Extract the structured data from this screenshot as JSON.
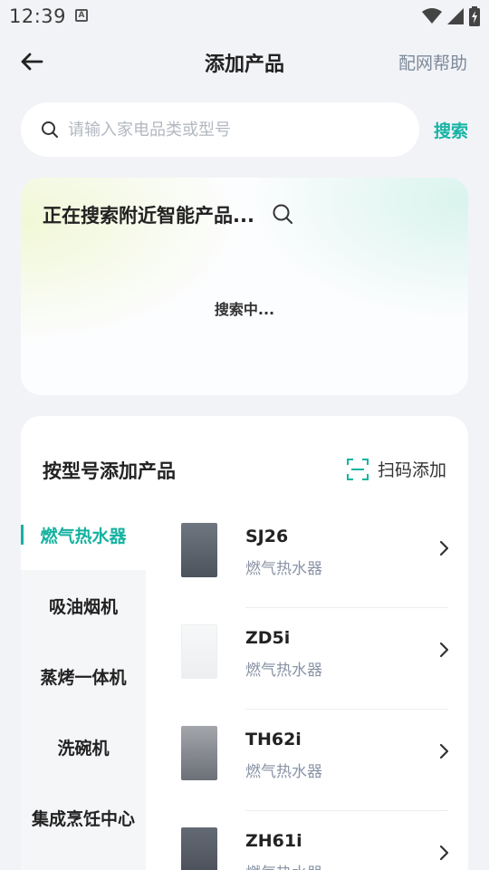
{
  "status_bar": {
    "time": "12:39",
    "notification_icon": "a-box-icon",
    "icons": [
      "wifi-icon",
      "signal-icon",
      "battery-icon"
    ]
  },
  "header": {
    "title": "添加产品",
    "help_label": "配网帮助",
    "back_icon": "arrow-left-icon"
  },
  "search": {
    "placeholder": "请输入家电品类或型号",
    "value": "",
    "button_label": "搜索",
    "accent": "#16b4a4"
  },
  "nearby": {
    "title": "正在搜索附近智能产品...",
    "status": "搜索中..."
  },
  "model_section": {
    "title": "按型号添加产品",
    "scan_label": "扫码添加",
    "categories": [
      {
        "label": "燃气热水器",
        "active": true
      },
      {
        "label": "吸油烟机",
        "active": false
      },
      {
        "label": "蒸烤一体机",
        "active": false
      },
      {
        "label": "洗碗机",
        "active": false
      },
      {
        "label": "集成烹饪中心",
        "active": false
      }
    ],
    "products": [
      {
        "name": "SJ26",
        "category": "燃气热水器",
        "thumb_color": "#5a626e"
      },
      {
        "name": "ZD5i",
        "category": "燃气热水器",
        "thumb_color": "#f4f5f6"
      },
      {
        "name": "TH62i",
        "category": "燃气热水器",
        "thumb_color": "#8c8f95"
      },
      {
        "name": "ZH61i",
        "category": "燃气热水器",
        "thumb_color": "#555a64"
      }
    ]
  }
}
